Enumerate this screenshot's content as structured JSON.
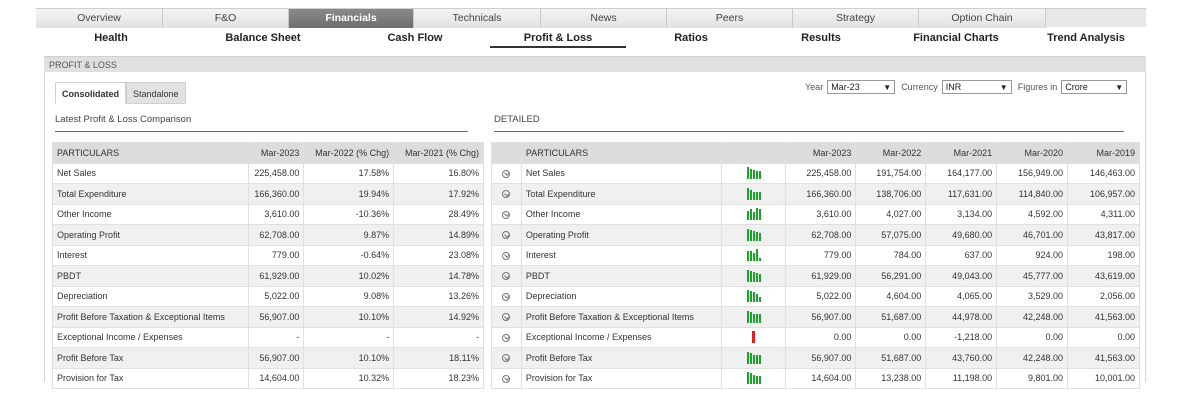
{
  "top_tabs": [
    "Overview",
    "F&O",
    "Financials",
    "Technicals",
    "News",
    "Peers",
    "Strategy",
    "Option Chain"
  ],
  "top_tabs_active": "Financials",
  "sub_tabs": [
    "Health",
    "Balance Sheet",
    "Cash Flow",
    "Profit & Loss",
    "Ratios",
    "Results",
    "Financial Charts",
    "Trend Analysis"
  ],
  "sub_tabs_active": "Profit & Loss",
  "section_title": "PROFIT & LOSS",
  "view_tabs": [
    "Consolidated",
    "Standalone"
  ],
  "filters": {
    "year_label": "Year",
    "year_value": "Mar-23",
    "currency_label": "Currency",
    "currency_value": "INR",
    "figures_label": "Figures in",
    "figures_value": "Crore"
  },
  "left": {
    "heading": "Latest Profit & Loss Comparison",
    "columns": [
      "PARTICULARS",
      "Mar-2023",
      "Mar-2022 (% Chg)",
      "Mar-2021 (% Chg)"
    ],
    "rows": [
      [
        "Net Sales",
        "225,458.00",
        "17.58%",
        "16.80%"
      ],
      [
        "Total Expenditure",
        "166,360.00",
        "19.94%",
        "17.92%"
      ],
      [
        "Other Income",
        "3,610.00",
        "-10.36%",
        "28.49%"
      ],
      [
        "Operating Profit",
        "62,708.00",
        "9.87%",
        "14.89%"
      ],
      [
        "Interest",
        "779.00",
        "-0.64%",
        "23.08%"
      ],
      [
        "PBDT",
        "61,929.00",
        "10.02%",
        "14.78%"
      ],
      [
        "Depreciation",
        "5,022.00",
        "9.08%",
        "13.26%"
      ],
      [
        "Profit Before Taxation & Exceptional Items",
        "56,907.00",
        "10.10%",
        "14.92%"
      ],
      [
        "Exceptional Income / Expenses",
        "-",
        "-",
        "-"
      ],
      [
        "Profit Before Tax",
        "56,907.00",
        "10.10%",
        "18.11%"
      ],
      [
        "Provision for Tax",
        "14,604.00",
        "10.32%",
        "18.23%"
      ]
    ]
  },
  "right": {
    "heading": "DETAILED",
    "columns": [
      "PARTICULARS",
      "Mar-2023",
      "Mar-2022",
      "Mar-2021",
      "Mar-2020",
      "Mar-2019"
    ],
    "rows": [
      [
        "Net Sales",
        "225,458.00",
        "191,754.00",
        "164,177.00",
        "156,949.00",
        "146,463.00"
      ],
      [
        "Total Expenditure",
        "166,360.00",
        "138,706.00",
        "117,631.00",
        "114,840.00",
        "106,957.00"
      ],
      [
        "Other Income",
        "3,610.00",
        "4,027.00",
        "3,134.00",
        "4,592.00",
        "4,311.00"
      ],
      [
        "Operating Profit",
        "62,708.00",
        "57,075.00",
        "49,680.00",
        "46,701.00",
        "43,817.00"
      ],
      [
        "Interest",
        "779.00",
        "784.00",
        "637.00",
        "924.00",
        "198.00"
      ],
      [
        "PBDT",
        "61,929.00",
        "56,291.00",
        "49,043.00",
        "45,777.00",
        "43,619.00"
      ],
      [
        "Depreciation",
        "5,022.00",
        "4,604.00",
        "4,065.00",
        "3,529.00",
        "2,056.00"
      ],
      [
        "Profit Before Taxation & Exceptional Items",
        "56,907.00",
        "51,687.00",
        "44,978.00",
        "42,248.00",
        "41,563.00"
      ],
      [
        "Exceptional Income / Expenses",
        "0.00",
        "0.00",
        "-1,218.00",
        "0.00",
        "0.00"
      ],
      [
        "Profit Before Tax",
        "56,907.00",
        "51,687.00",
        "43,760.00",
        "42,248.00",
        "41,563.00"
      ],
      [
        "Provision for Tax",
        "14,604.00",
        "13,238.00",
        "11,198.00",
        "9,801.00",
        "10,001.00"
      ]
    ],
    "spark_color": "#1aa52a",
    "spark_negative_color": "#e02020"
  }
}
